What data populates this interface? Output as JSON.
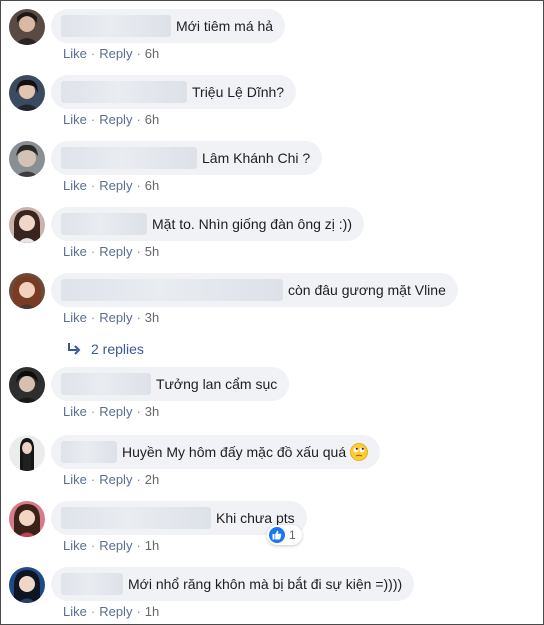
{
  "actions": {
    "like": "Like",
    "reply": "Reply",
    "separator": "·"
  },
  "comments": [
    {
      "text": "Mới tiêm má hả",
      "time": "6h",
      "avatar_icon": "user-avatar-icon"
    },
    {
      "text": "Triệu Lệ Dĩnh?",
      "time": "6h",
      "avatar_icon": "user-avatar-icon"
    },
    {
      "text": "Lâm Khánh Chi ?",
      "time": "6h",
      "avatar_icon": "user-avatar-icon"
    },
    {
      "text": "Mặt to. Nhìn giống đàn ông zị :))",
      "time": "5h",
      "avatar_icon": "user-avatar-icon"
    },
    {
      "text": "còn đâu gương mặt Vline",
      "time": "3h",
      "avatar_icon": "user-avatar-icon"
    },
    {
      "text": "Tưởng lan cẩm sục",
      "time": "3h",
      "avatar_icon": "user-avatar-icon"
    },
    {
      "text": "Huyền My hôm đấy mặc đồ xấu quá",
      "time": "2h",
      "avatar_icon": "user-avatar-icon",
      "emoji_icon": "eye-roll-emoji-icon"
    },
    {
      "text": "Khi chưa pts",
      "time": "1h",
      "avatar_icon": "user-avatar-icon",
      "reaction_count": "1",
      "reaction_icon": "like-reaction-icon"
    },
    {
      "text": "Mới nhổ răng khôn mà bị bắt đi sự kiện =))))",
      "time": "1h",
      "avatar_icon": "user-avatar-icon"
    }
  ],
  "replies_link": {
    "label": "2 replies",
    "icon": "reply-arrow-icon"
  },
  "colors": {
    "bubble": "#f0f2f5",
    "link": "#385898",
    "like_blue": "#1877f2",
    "meta": "#65676b"
  }
}
